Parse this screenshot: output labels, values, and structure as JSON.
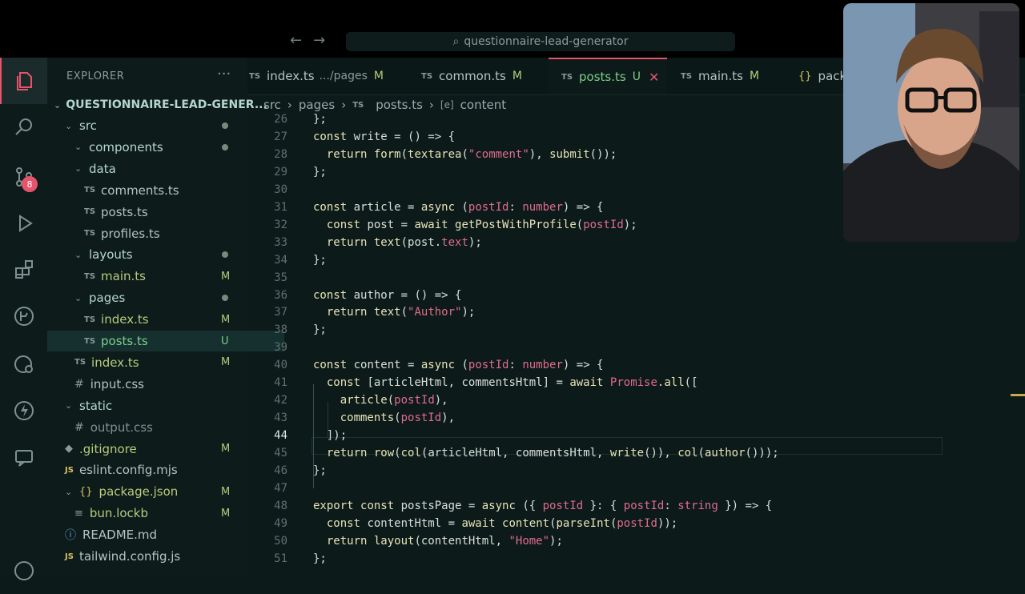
{
  "command_center": {
    "text": "questionnaire-lead-generator"
  },
  "explorer": {
    "title": "EXPLORER",
    "more": "···",
    "root": "QUESTIONNAIRE-LEAD-GENER...",
    "tree": [
      {
        "type": "folder",
        "name": "src",
        "depth": 1,
        "dot": true
      },
      {
        "type": "folder",
        "name": "components",
        "depth": 2,
        "dot": true
      },
      {
        "type": "folder",
        "name": "data",
        "depth": 2
      },
      {
        "type": "ts",
        "name": "comments.ts",
        "depth": 3
      },
      {
        "type": "ts",
        "name": "posts.ts",
        "depth": 3
      },
      {
        "type": "ts",
        "name": "profiles.ts",
        "depth": 3
      },
      {
        "type": "folder",
        "name": "layouts",
        "depth": 2,
        "dot": true
      },
      {
        "type": "ts",
        "name": "main.ts",
        "depth": 3,
        "status": "M"
      },
      {
        "type": "folder",
        "name": "pages",
        "depth": 2,
        "dot": true
      },
      {
        "type": "ts",
        "name": "index.ts",
        "depth": 3,
        "status": "M"
      },
      {
        "type": "ts",
        "name": "posts.ts",
        "depth": 3,
        "status": "U",
        "selected": true
      },
      {
        "type": "ts",
        "name": "index.ts",
        "depth": 2,
        "status": "M"
      },
      {
        "type": "css",
        "name": "input.css",
        "depth": 2
      },
      {
        "type": "folder",
        "name": "static",
        "depth": 1
      },
      {
        "type": "css",
        "name": "output.css",
        "depth": 2,
        "ignored": true
      },
      {
        "type": "git",
        "name": ".gitignore",
        "depth": 1,
        "status": "M"
      },
      {
        "type": "js",
        "name": "eslint.config.mjs",
        "depth": 1
      },
      {
        "type": "json",
        "name": "package.json",
        "depth": 1,
        "status": "M",
        "expanded": true
      },
      {
        "type": "lock",
        "name": "bun.lockb",
        "depth": 2,
        "status": "M"
      },
      {
        "type": "md",
        "name": "README.md",
        "depth": 1
      },
      {
        "type": "js",
        "name": "tailwind.config.js",
        "depth": 1
      }
    ]
  },
  "activity": {
    "scm_badge": "8"
  },
  "tabs": [
    {
      "icon": "TS",
      "name": "index.ts",
      "dir": ".../pages",
      "status": "M"
    },
    {
      "icon": "TS",
      "name": "common.ts",
      "status": "M"
    },
    {
      "icon": "TS",
      "name": "posts.ts",
      "status": "U",
      "active": true,
      "close": "✕"
    },
    {
      "icon": "TS",
      "name": "main.ts",
      "status": "M"
    },
    {
      "icon": "{}",
      "name": "pack"
    }
  ],
  "breadcrumb": [
    "src",
    "pages",
    "posts.ts",
    "content"
  ],
  "breadcrumb_icons": {
    "ts": "TS",
    "symbol": "[e]"
  },
  "editor": {
    "current_line": 44,
    "lines": [
      {
        "n": "26",
        "t": "};"
      },
      {
        "n": "27",
        "t": ""
      },
      {
        "n": "28",
        "t": ""
      },
      {
        "n": "29",
        "t": "};"
      },
      {
        "n": "30",
        "t": ""
      },
      {
        "n": "31",
        "t": ""
      },
      {
        "n": "32",
        "t": ""
      },
      {
        "n": "33",
        "t": ""
      },
      {
        "n": "34",
        "t": "};"
      },
      {
        "n": "35",
        "t": ""
      },
      {
        "n": "36",
        "t": ""
      },
      {
        "n": "37",
        "t": ""
      },
      {
        "n": "38",
        "t": "};"
      },
      {
        "n": "39",
        "t": ""
      },
      {
        "n": "40",
        "t": ""
      },
      {
        "n": "41",
        "t": ""
      },
      {
        "n": "42",
        "t": ""
      },
      {
        "n": "43",
        "t": ""
      },
      {
        "n": "44",
        "t": ""
      },
      {
        "n": "45",
        "t": ""
      },
      {
        "n": "46",
        "t": "};"
      },
      {
        "n": "47",
        "t": ""
      },
      {
        "n": "48",
        "t": ""
      },
      {
        "n": "49",
        "t": ""
      },
      {
        "n": "50",
        "t": ""
      },
      {
        "n": "51",
        "t": "};"
      }
    ]
  }
}
